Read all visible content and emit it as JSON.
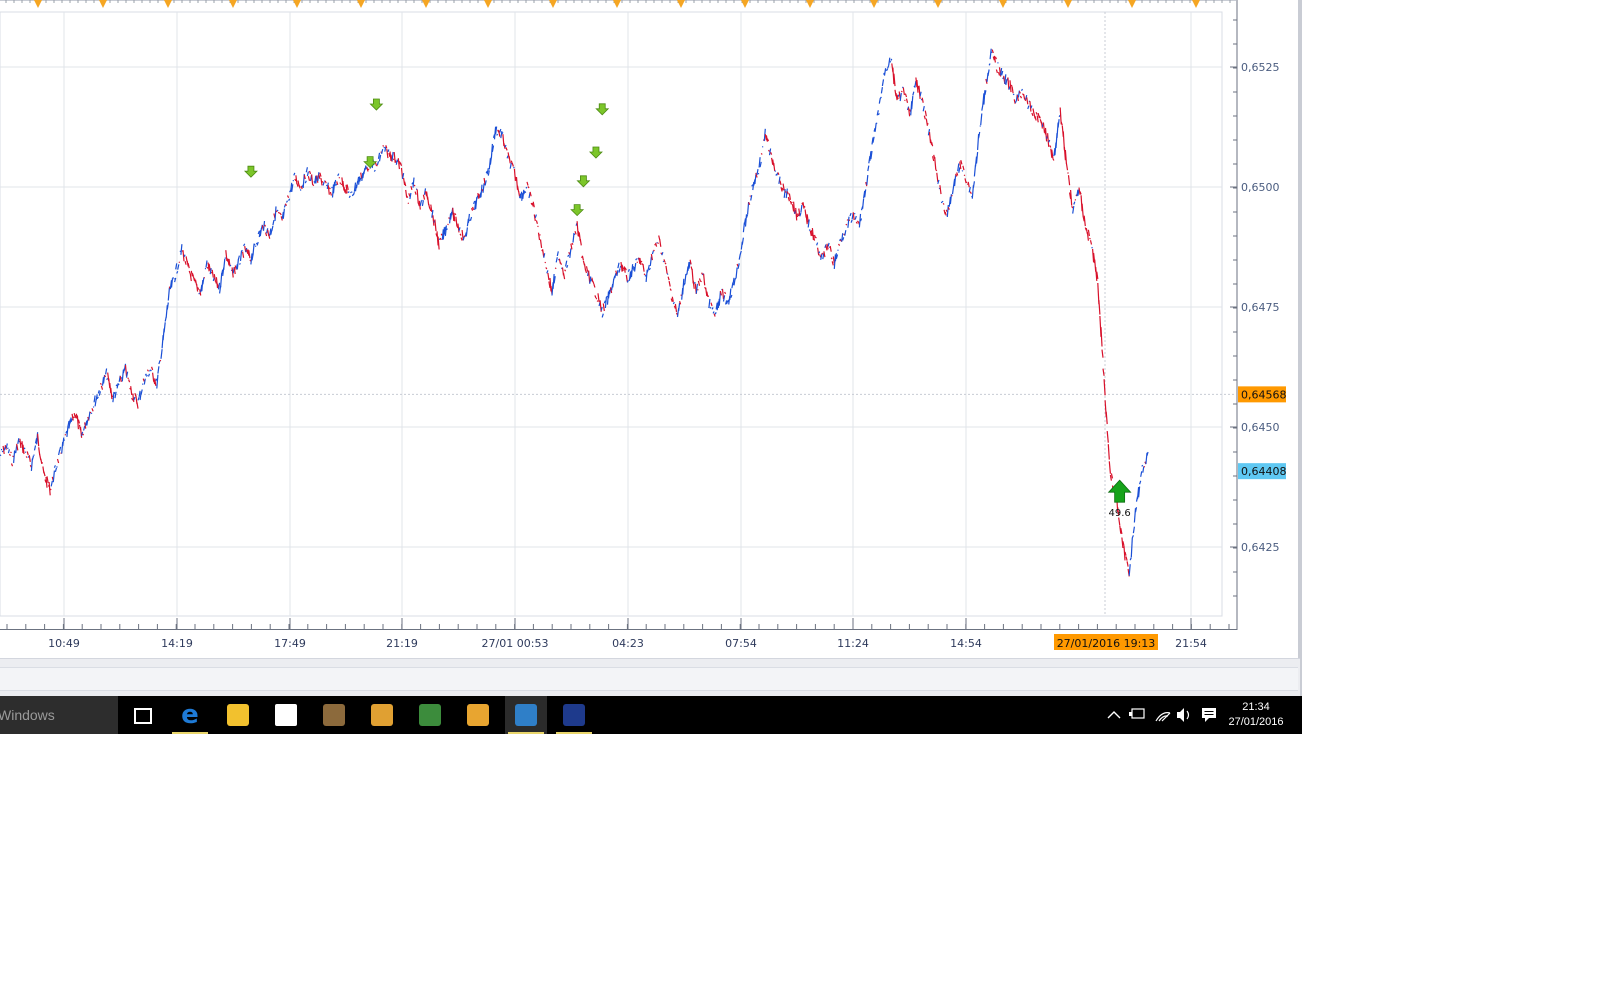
{
  "chart_data": {
    "type": "line",
    "ylim": [
      0.641,
      0.6535
    ],
    "yticks": [
      "0,6525",
      "0,6500",
      "0,6475",
      "0,6450",
      "0,6425"
    ],
    "ytick_values": [
      0.6525,
      0.65,
      0.6475,
      0.645,
      0.6425
    ],
    "xticks": [
      "10:49",
      "14:19",
      "17:49",
      "21:19",
      "27/01 00:53",
      "04:23",
      "07:54",
      "11:24",
      "14:54",
      "21:54"
    ],
    "current_time_label": "27/01/2016 19:13",
    "price_levels": [
      {
        "label": "0,64568",
        "value": 0.64568,
        "color": "#ff9900"
      },
      {
        "label": "0,64408",
        "value": 0.64408,
        "color": "#5fc8f2"
      }
    ],
    "series": [
      {
        "x": [
          0,
          1,
          2,
          3,
          4,
          5,
          6,
          7,
          8,
          9,
          10,
          11,
          12,
          13,
          14,
          15,
          16,
          17,
          18,
          19,
          20,
          21,
          22,
          23,
          24,
          25,
          26,
          27,
          28,
          29,
          30,
          31,
          32,
          33,
          34,
          35,
          36,
          37,
          38,
          39,
          40,
          41,
          42,
          43,
          44,
          45,
          46,
          47,
          48,
          49,
          50,
          51,
          52,
          53,
          54,
          55,
          56,
          57,
          58,
          59,
          60,
          61,
          62,
          63,
          64,
          65,
          66,
          67,
          68,
          69,
          70,
          71,
          72,
          73,
          74,
          75,
          76,
          77,
          78,
          79,
          80,
          81,
          82,
          83,
          84,
          85,
          86,
          87,
          88,
          89,
          90,
          91,
          92,
          93,
          94,
          95,
          96,
          97,
          98,
          99,
          100,
          101,
          102,
          103,
          104,
          105,
          106,
          107,
          108,
          109,
          110,
          111,
          112,
          113,
          114,
          115,
          116,
          117,
          118,
          119,
          120,
          121,
          122,
          123,
          124,
          125,
          126,
          127,
          128,
          129,
          130,
          131,
          132,
          133,
          134,
          135,
          136,
          137,
          138,
          139,
          140,
          141,
          142,
          143,
          144,
          145,
          146,
          147,
          148,
          149,
          150,
          151,
          152,
          153,
          154,
          155,
          156,
          157,
          158,
          159,
          160,
          161,
          162,
          163,
          164,
          165,
          166,
          167,
          168,
          169,
          170,
          171,
          172,
          173,
          174,
          175,
          176,
          177,
          178,
          179,
          180,
          181,
          182,
          183
        ],
        "values": [
          0.6444,
          0.6446,
          0.6443,
          0.6447,
          0.6445,
          0.6442,
          0.6448,
          0.644,
          0.6437,
          0.6442,
          0.6446,
          0.645,
          0.6453,
          0.6448,
          0.6452,
          0.6455,
          0.6458,
          0.6461,
          0.6456,
          0.6459,
          0.6462,
          0.6457,
          0.6455,
          0.646,
          0.6462,
          0.6459,
          0.6468,
          0.6478,
          0.6482,
          0.6487,
          0.6483,
          0.648,
          0.6478,
          0.6484,
          0.6481,
          0.6479,
          0.6486,
          0.6482,
          0.6484,
          0.6487,
          0.6485,
          0.6489,
          0.6492,
          0.649,
          0.6495,
          0.6493,
          0.6498,
          0.6502,
          0.65,
          0.6503,
          0.6501,
          0.6502,
          0.65,
          0.6499,
          0.6502,
          0.65,
          0.6498,
          0.6501,
          0.6503,
          0.6505,
          0.6504,
          0.6508,
          0.6507,
          0.6506,
          0.6504,
          0.6497,
          0.6501,
          0.6496,
          0.6499,
          0.6494,
          0.6488,
          0.6491,
          0.6495,
          0.6492,
          0.6489,
          0.6494,
          0.6497,
          0.65,
          0.6504,
          0.6512,
          0.6511,
          0.6506,
          0.6503,
          0.6498,
          0.65,
          0.6496,
          0.649,
          0.6484,
          0.6478,
          0.6486,
          0.6482,
          0.6487,
          0.6492,
          0.6484,
          0.6481,
          0.6478,
          0.6474,
          0.6477,
          0.6481,
          0.6484,
          0.6481,
          0.6483,
          0.6485,
          0.6481,
          0.6486,
          0.6489,
          0.6484,
          0.6478,
          0.6473,
          0.648,
          0.6484,
          0.6478,
          0.6482,
          0.6476,
          0.6473,
          0.6478,
          0.6476,
          0.648,
          0.6486,
          0.6494,
          0.65,
          0.6504,
          0.6511,
          0.6506,
          0.6502,
          0.6499,
          0.6498,
          0.6494,
          0.6496,
          0.6492,
          0.6489,
          0.6485,
          0.6488,
          0.6484,
          0.6489,
          0.6492,
          0.6494,
          0.6492,
          0.65,
          0.6508,
          0.6515,
          0.6524,
          0.6527,
          0.6518,
          0.652,
          0.6515,
          0.6522,
          0.6518,
          0.6512,
          0.6505,
          0.6498,
          0.6494,
          0.65,
          0.6505,
          0.6502,
          0.6498,
          0.651,
          0.652,
          0.6528,
          0.6525,
          0.6523,
          0.6521,
          0.6518,
          0.652,
          0.6517,
          0.6515,
          0.6514,
          0.651,
          0.6506,
          0.6516,
          0.6505,
          0.6495,
          0.65,
          0.6492,
          0.6488,
          0.648,
          0.646,
          0.644,
          0.6435,
          0.6425,
          0.642,
          0.6432,
          0.6441,
          0.6444
        ]
      }
    ],
    "sell_signals": [
      {
        "x": 40,
        "value": 0.6501
      },
      {
        "x": 59,
        "value": 0.6503
      },
      {
        "x": 60,
        "value": 0.6515
      },
      {
        "x": 92,
        "value": 0.6493
      },
      {
        "x": 93,
        "value": 0.6499
      },
      {
        "x": 95,
        "value": 0.6505
      },
      {
        "x": 96,
        "value": 0.6514
      }
    ],
    "buy_signal": {
      "x": 178,
      "value": 0.6436,
      "label": "49.6"
    }
  },
  "taskbar": {
    "search_text": "Windows",
    "icons": [
      {
        "name": "task-view-icon",
        "color": "#000000",
        "running": false,
        "active": false
      },
      {
        "name": "edge-icon",
        "color": "#1e7ad6",
        "running": true,
        "active": false
      },
      {
        "name": "file-explorer-icon",
        "color": "#f2c12e",
        "running": false,
        "active": false
      },
      {
        "name": "store-icon",
        "color": "#ffffff",
        "running": false,
        "active": false
      },
      {
        "name": "media-player-icon",
        "color": "#8c6a3c",
        "running": false,
        "active": false
      },
      {
        "name": "app-orange-icon",
        "color": "#e0a032",
        "running": false,
        "active": false
      },
      {
        "name": "app-green-plus-icon",
        "color": "#3c8c3c",
        "running": false,
        "active": false
      },
      {
        "name": "app-notes-icon",
        "color": "#e8a530",
        "running": false,
        "active": false
      },
      {
        "name": "trading-app-icon",
        "color": "#2f7fc8",
        "running": true,
        "active": true
      },
      {
        "name": "league-icon",
        "color": "#1e3a8c",
        "running": true,
        "active": false
      }
    ],
    "clock_time": "21:34",
    "clock_date": "27/01/2016"
  }
}
